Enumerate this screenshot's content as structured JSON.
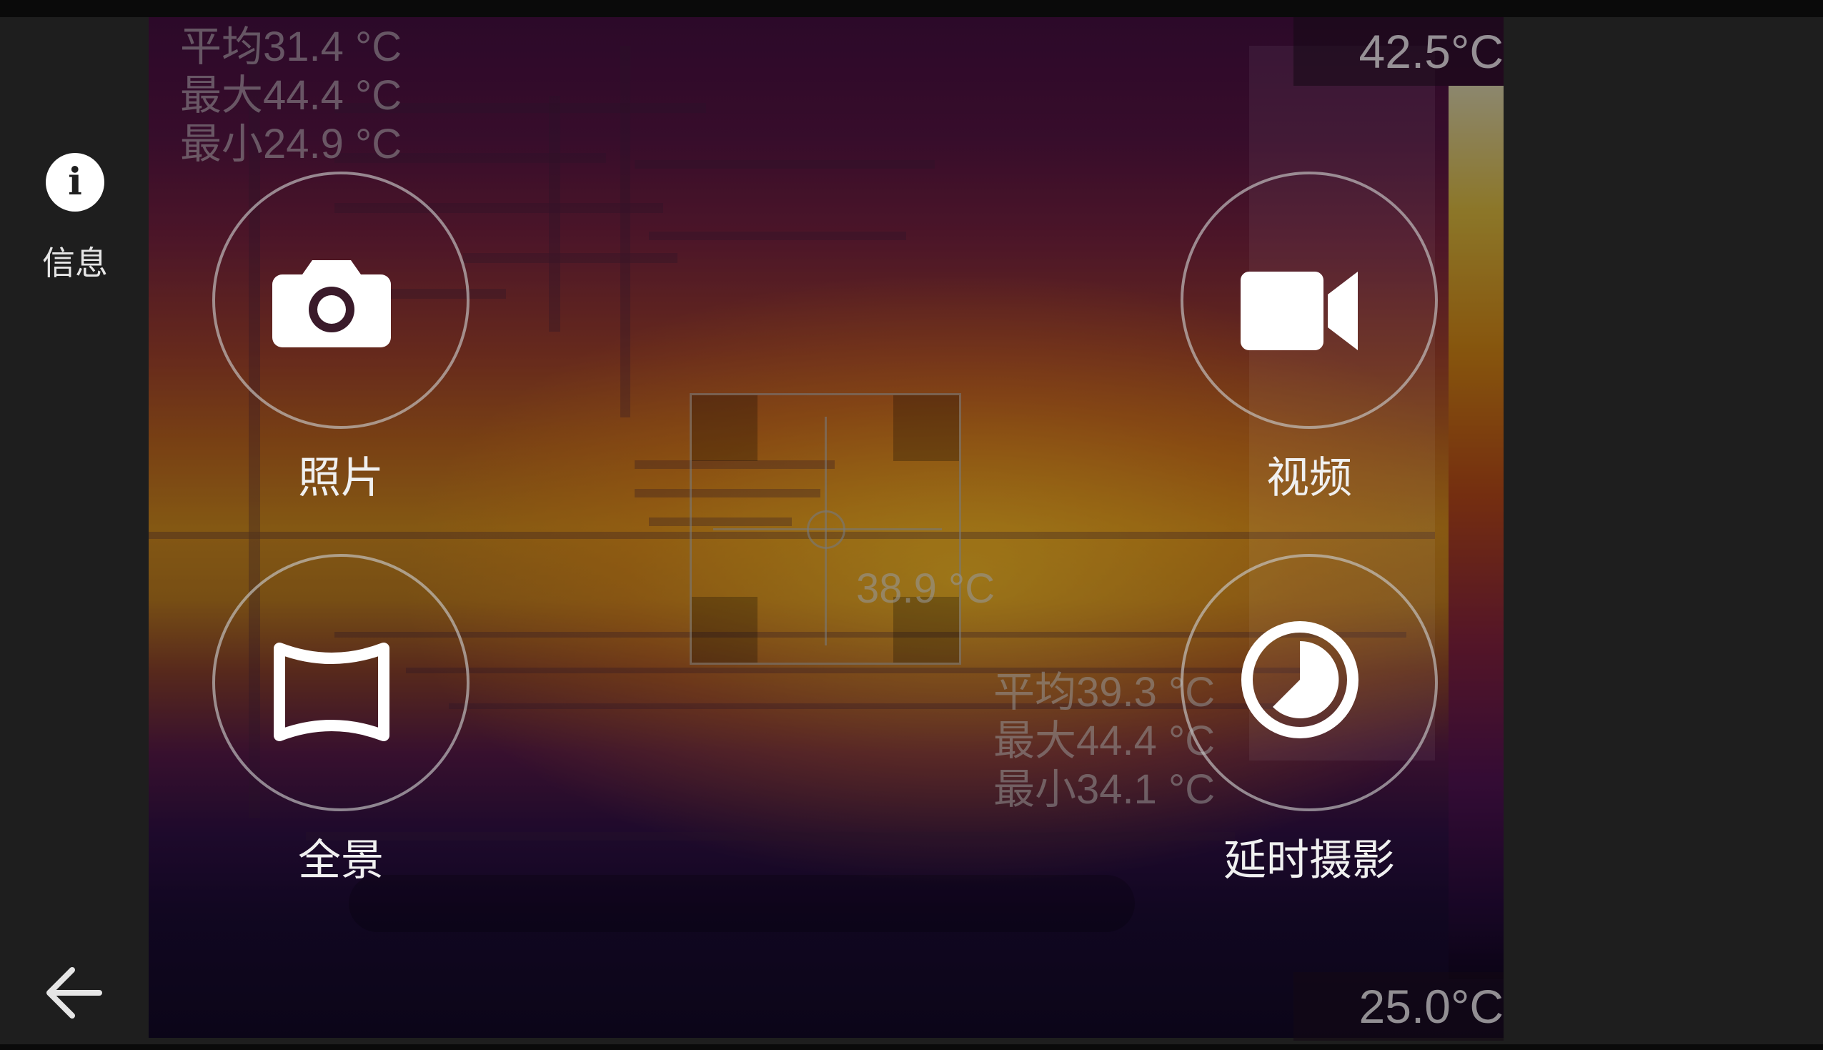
{
  "sidebar": {
    "info_label": "信息",
    "info_icon": "info-icon",
    "back_icon": "back-arrow-icon"
  },
  "thermal": {
    "scale_max": "42.5°C",
    "scale_min": "25.0°C",
    "global_stats": {
      "avg": "平均31.4 °C",
      "max": "最大44.4 °C",
      "min": "最小24.9 °C"
    },
    "box_stats": {
      "avg": "平均39.3 °C",
      "max": "最大44.4 °C",
      "min": "最小34.1 °C"
    },
    "center_temp": "38.9 °C",
    "palette": [
      "#fff6c8",
      "#ffd84a",
      "#f59a18",
      "#d4541e",
      "#9a2848",
      "#5e1660",
      "#150828"
    ]
  },
  "modes": {
    "photo": {
      "label": "照片",
      "icon": "camera-icon"
    },
    "video": {
      "label": "视频",
      "icon": "video-camera-icon"
    },
    "panorama": {
      "label": "全景",
      "icon": "panorama-icon"
    },
    "timelapse": {
      "label": "延时摄影",
      "icon": "timelapse-icon"
    }
  }
}
